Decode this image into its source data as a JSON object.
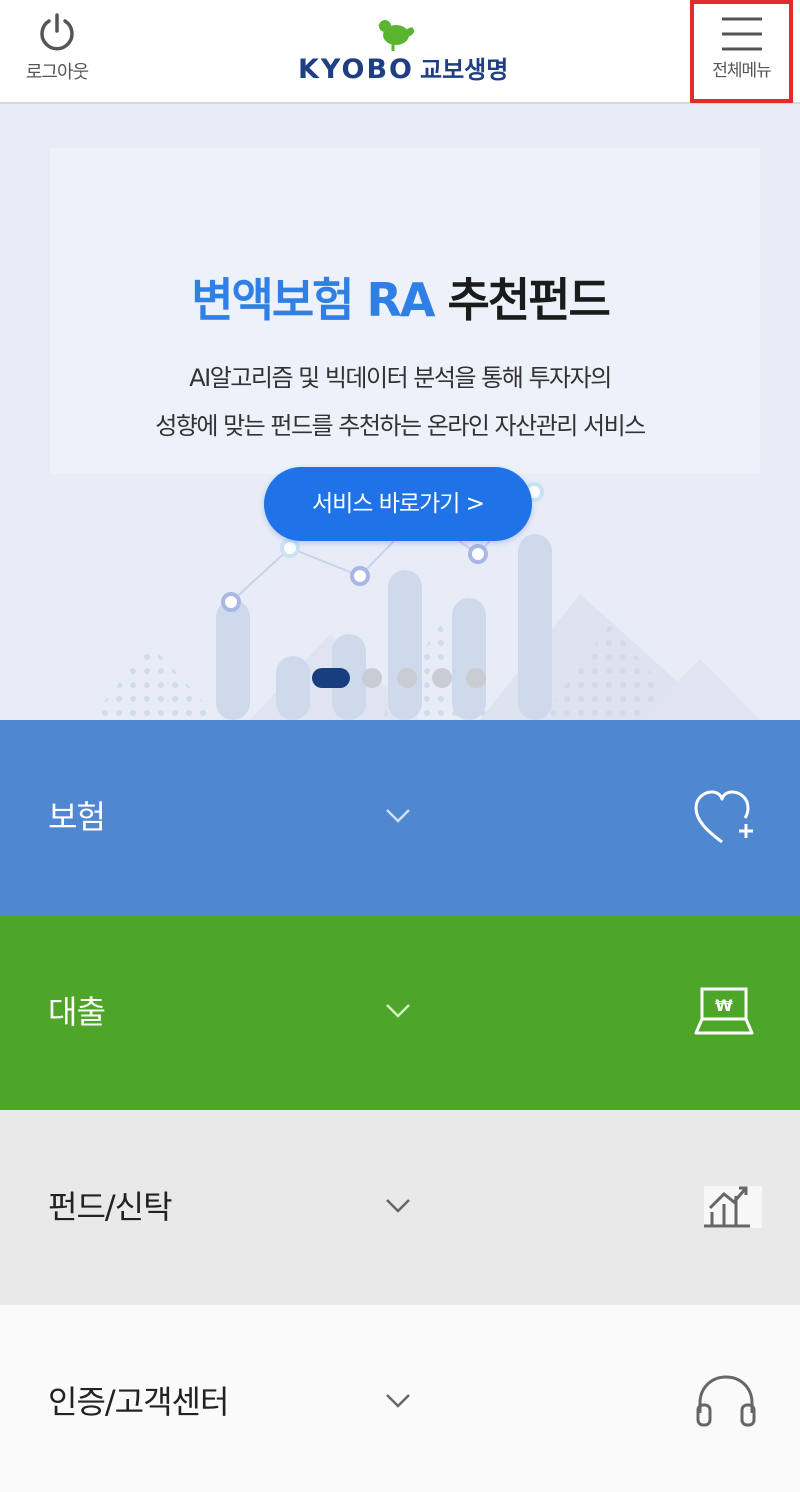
{
  "header": {
    "logout_label": "로그아웃",
    "logo_text": "KYOBO",
    "logo_korean": "교보생명",
    "menu_label": "전체메뉴"
  },
  "banner": {
    "title_blue": "변액보험 RA",
    "title_dark": "추천펀드",
    "desc_line1": "AI알고리즘 및 빅데이터 분석을 통해 투자자의",
    "desc_line2": "성향에 맞는 펀드를 추천하는 온라인 자산관리 서비스",
    "button_label": "서비스 바로가기 >",
    "slide_count": 5,
    "active_slide": 1
  },
  "menu": [
    {
      "label": "보험",
      "icon": "heart-plus-icon",
      "color": "#4f87d1"
    },
    {
      "label": "대출",
      "icon": "laptop-won-icon",
      "color": "#4ea629"
    },
    {
      "label": "펀드/신탁",
      "icon": "chart-up-icon",
      "color": "#e9e9e9"
    },
    {
      "label": "인증/고객센터",
      "icon": "headset-icon",
      "color": "#fafafa"
    }
  ],
  "colors": {
    "brand_navy": "#1e3f86",
    "brand_green": "#5cb531",
    "highlight_red": "#e32b2b",
    "banner_blue": "#2f7fe4",
    "button_blue": "#1f73e6"
  }
}
